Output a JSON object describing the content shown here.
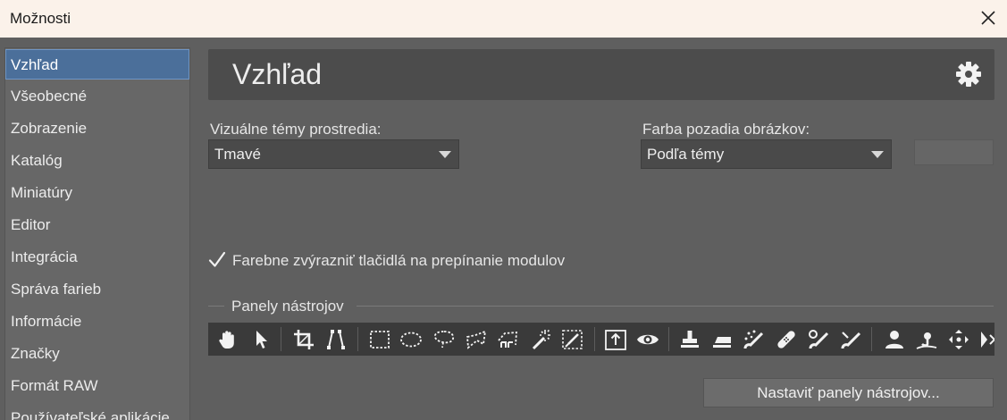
{
  "window": {
    "title": "Možnosti"
  },
  "sidebar": {
    "items": [
      {
        "label": "Vzhľad",
        "selected": true
      },
      {
        "label": "Všeobecné"
      },
      {
        "label": "Zobrazenie"
      },
      {
        "label": "Katalóg"
      },
      {
        "label": "Miniatúry"
      },
      {
        "label": "Editor"
      },
      {
        "label": "Integrácia"
      },
      {
        "label": "Správa farieb"
      },
      {
        "label": "Informácie"
      },
      {
        "label": "Značky"
      },
      {
        "label": "Formát RAW"
      },
      {
        "label": "Používateľské aplikácie"
      }
    ]
  },
  "header": {
    "title": "Vzhľad",
    "icon": "gear-icon"
  },
  "theme": {
    "label": "Vizuálne témy prostredia:",
    "value": "Tmavé"
  },
  "background": {
    "label": "Farba pozadia obrázkov:",
    "value": "Podľa témy",
    "swatch_color": "#666666"
  },
  "highlight": {
    "label": "Farebne zvýrazniť tlačidlá na prepínanie modulov",
    "checked": true
  },
  "toolbars": {
    "section_label": "Panely nástrojov",
    "tools": [
      "hand-icon",
      "pointer-icon",
      "crop-icon",
      "perspective-icon",
      "rect-select-icon",
      "ellipse-select-icon",
      "lasso-icon",
      "polygon-lasso-icon",
      "magnetic-lasso-icon",
      "magic-wand-icon",
      "brush-select-icon",
      "export-icon",
      "red-eye-icon",
      "stamp-icon",
      "eraser-icon",
      "spot-brush-icon",
      "bandage-icon",
      "clone-brush-icon",
      "heal-brush-icon",
      "person-icon",
      "dodge-icon",
      "move-icon",
      "more-icon"
    ],
    "configure_button": "Nastaviť panely nástrojov..."
  },
  "colors": {
    "accent": "#4b6f9a",
    "panel": "#5f5f5f",
    "header": "#4c4c4c",
    "toolbar": "#3a3a3a"
  }
}
